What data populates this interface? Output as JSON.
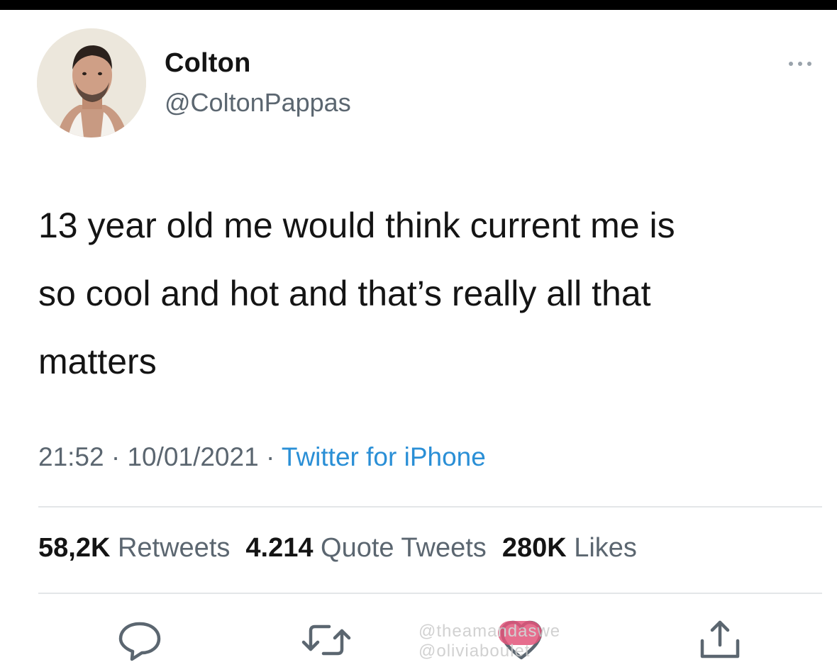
{
  "tweet": {
    "author": {
      "name": "Colton",
      "handle": "@ColtonPappas"
    },
    "text_lines": [
      "13 year old me would think current me is",
      "so cool and hot and that’s really all that",
      "matters"
    ],
    "time": "21:52",
    "date": "10/01/2021",
    "separator": "·",
    "source": "Twitter for iPhone",
    "stats": {
      "retweets_count": "58,2K",
      "retweets_label": "Retweets",
      "quotes_count": "4.214",
      "quotes_label": "Quote Tweets",
      "likes_count": "280K",
      "likes_label": "Likes"
    }
  },
  "actions": [
    "reply-icon",
    "retweet-icon",
    "like-icon",
    "share-icon"
  ],
  "watermark": {
    "line1": "@theamandaswe",
    "line2": "@oliviaboulet"
  },
  "colors": {
    "text": "#141414",
    "secondary": "#5b6670",
    "source_link": "#2a8fd6",
    "divider": "#e3e6e8"
  }
}
